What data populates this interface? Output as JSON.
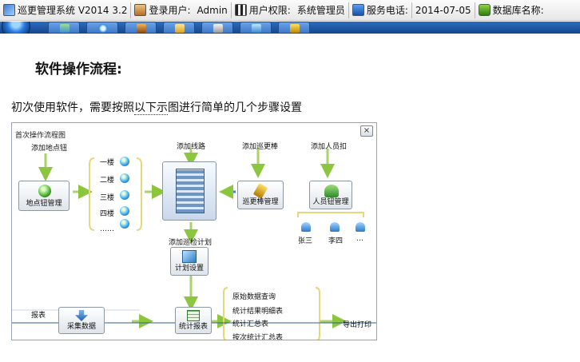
{
  "statusbar": {
    "app_title": "巡更管理系统 V2014 3.2",
    "login_label": "登录用户:",
    "login_value": "Admin",
    "perm_label": "用户权限:",
    "perm_value": "系统管理员",
    "phone_label": "服务电话:",
    "date": "2014-07-05",
    "db_label": "数据库名称:"
  },
  "main": {
    "heading": "软件操作流程:",
    "intro_a": "初次使用软件，需要按照",
    "intro_b": "以下示",
    "intro_c": "图进行简单的几个步骤设置"
  },
  "diagram": {
    "title": "首次操作流程图",
    "close": "×",
    "step_add_location": "添加地点钮",
    "step_add_route": "添加线路",
    "step_add_patrol": "添加巡更棒",
    "step_add_staff": "添加人员扣",
    "box_location": "地点钮管理",
    "box_patrol": "巡更棒管理",
    "box_staff": "人员钮管理",
    "floors": [
      "一楼",
      "二楼",
      "三楼",
      "四楼",
      "……"
    ],
    "people": [
      "张三",
      "李四",
      "…"
    ],
    "step_add_plan": "添加巡检计划",
    "box_plan": "计划设置",
    "report_label": "报表",
    "box_collect": "采集数据",
    "box_stats": "统计报表",
    "report_items": [
      "原始数据查询",
      "统计结果明细表",
      "统计汇总表",
      "按次统计汇总表"
    ],
    "export": "导出打印"
  }
}
